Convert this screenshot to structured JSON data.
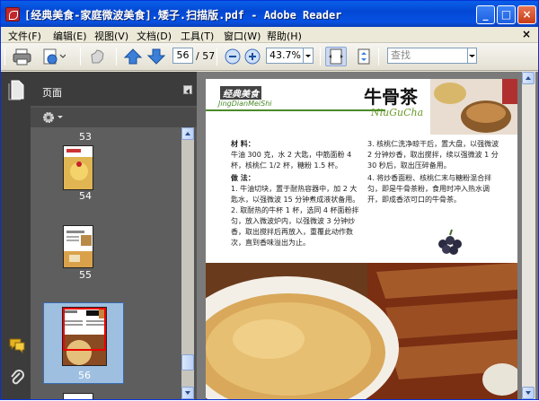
{
  "window": {
    "title": "[经典美食-家庭微波美食].矮子.扫描版.pdf - Adobe Reader",
    "min_label": "_",
    "max_label": "□",
    "close_label": "×"
  },
  "menu": {
    "items": [
      "文件(F)",
      "编辑(E)",
      "视图(V)",
      "文档(D)",
      "工具(T)",
      "窗口(W)",
      "帮助(H)"
    ],
    "close_glyph": "×"
  },
  "toolbar": {
    "page_current": "56",
    "page_total": "/ 57",
    "zoom": "43.7%",
    "find_placeholder": "查找"
  },
  "panel": {
    "title": "页面",
    "thumbnails": [
      {
        "label": "53"
      },
      {
        "label": "54"
      },
      {
        "label": "55"
      },
      {
        "label": "56",
        "selected": true
      }
    ]
  },
  "document": {
    "header_label": "经典美食",
    "header_pinyin": "JingDianMeiShi",
    "dish_title": "牛骨茶",
    "dish_pinyin": "NiuGuCha",
    "ingredients_heading": "材  料：",
    "ingredients_text": "牛油 300 克，水 2 大匙，中筋面粉 4 杯，核桃仁 1/2 杯，糖粉 1.5 杯。",
    "method_heading": "做  法：",
    "steps_left": [
      "1. 牛油切块，置于耐热容器中，加 2 大匙水，以强微波 15 分钟煮成液状备用。",
      "2. 取耐热的牛杯 1 杯，选同 4 杯面粉拌匀，放入微波炉内，以强微波 3 分钟炒香，取出搅拌后再放入，重覆此动作数次，直到香味溢出为止。"
    ],
    "steps_right": [
      "3. 核桃仁洗净晾干后，置大盘，以强微波 2 分钟炒香，取出搅拌，续以强微波 1 分 30 秒后，取出压碎备用。",
      "4. 将炒香面粉、核桃仁末与糖粉混合拌匀，即是牛骨茶粉，食用时冲入热水调开，即成香浓可口的牛骨茶。"
    ]
  },
  "colors": {
    "title_blue": "#0752e3",
    "header_green": "#4a8a2a",
    "selected_thumb": "#9fbfe0"
  }
}
